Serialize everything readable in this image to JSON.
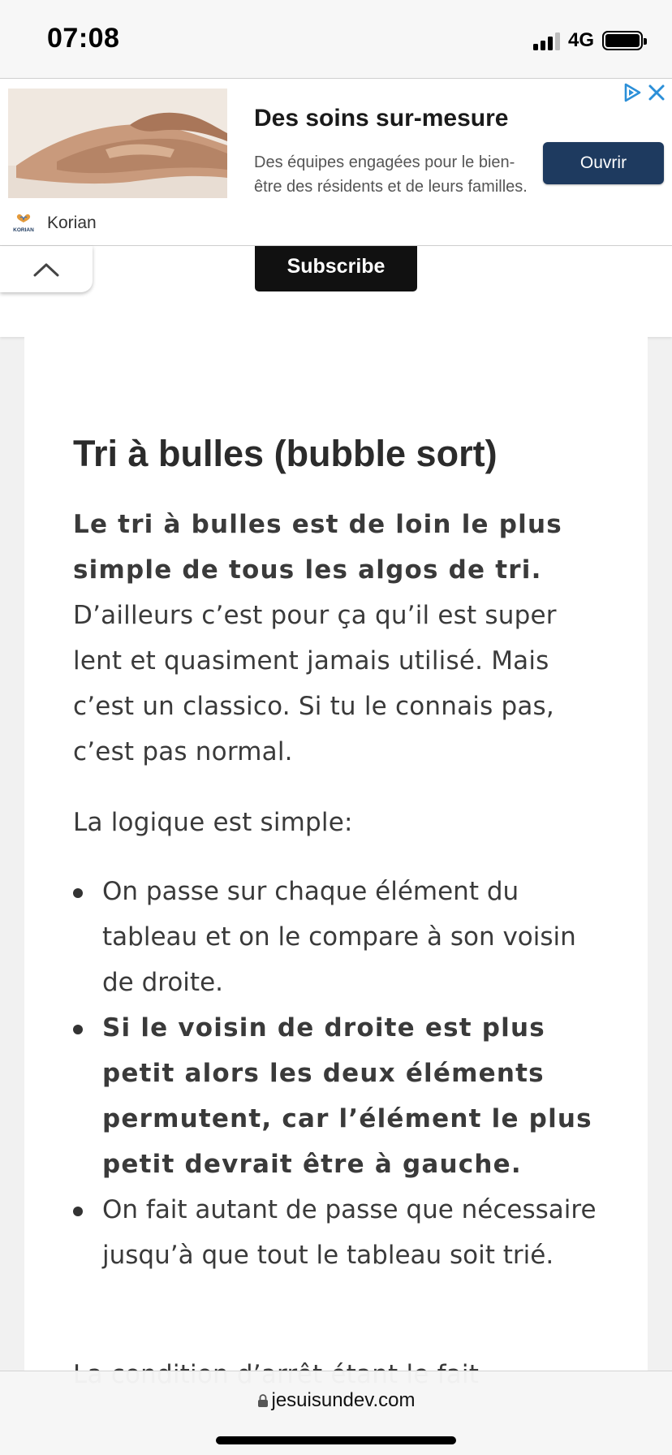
{
  "status_bar": {
    "time": "07:08",
    "network": "4G"
  },
  "ad": {
    "title": "Des soins sur-mesure",
    "description": "Des équipes engagées pour le bien-être des résidents et de leurs familles.",
    "cta_label": "Ouvrir",
    "brand": "Korian",
    "brand_logo_text": "KORIAN",
    "colors": {
      "cta_background": "#1e3a5f",
      "choices_icon": "#2b8fd8"
    }
  },
  "subscribe": {
    "label": "Subscribe"
  },
  "article": {
    "heading": "Tri à bulles (bubble sort)",
    "intro_bold": "Le tri à bulles est de loin le plus simple de tous les algos de tri.",
    "intro_rest": " D’ailleurs c’est pour ça qu’il est super lent et quasiment jamais utilisé. Mais c’est un classico. Si tu le connais pas, c’est pas normal.",
    "logic_intro": "La logique est simple:",
    "bullets": [
      "On passe sur chaque élément du tableau et on le compare à son voisin de droite.",
      "Si le voisin de droite est plus petit alors les deux éléments permutent, car l’élément le plus petit devrait être à gauche.",
      "On fait autant de passe que nécessaire jusqu’à que tout le tableau soit trié."
    ],
    "cut_off_text": "La condition d’arrêt étant le fait"
  },
  "browser": {
    "url": "jesuisundev.com"
  }
}
